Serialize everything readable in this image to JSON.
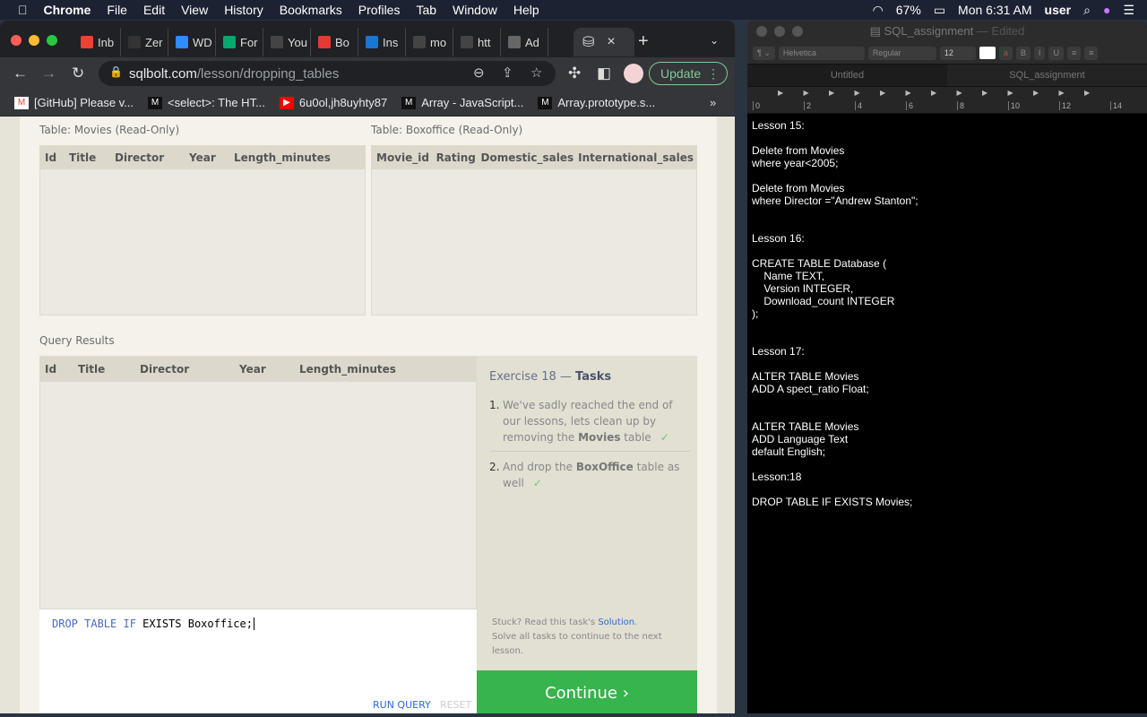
{
  "menubar": {
    "app": "Chrome",
    "items": [
      "File",
      "Edit",
      "View",
      "History",
      "Bookmarks",
      "Profiles",
      "Tab",
      "Window",
      "Help"
    ],
    "battery": "67%",
    "clock": "Mon 6:31 AM",
    "user": "user"
  },
  "browser": {
    "tabs": [
      {
        "label": "Inb",
        "icon": "gmail-icon",
        "color": "#ea4335"
      },
      {
        "label": "Zer",
        "icon": "zero-icon",
        "color": "#333"
      },
      {
        "label": "WD",
        "icon": "zoom-icon",
        "color": "#2d8cff"
      },
      {
        "label": "For",
        "icon": "w3-icon",
        "color": "#04aa6d"
      },
      {
        "label": "You",
        "icon": "github-icon",
        "color": "#444"
      },
      {
        "label": "Bo",
        "icon": "s-icon",
        "color": "#e53935"
      },
      {
        "label": "Ins",
        "icon": "mj-icon",
        "color": "#1976d2"
      },
      {
        "label": "mo",
        "icon": "mockapi-icon",
        "color": "#444"
      },
      {
        "label": "htt",
        "icon": "mockapi-icon",
        "color": "#444"
      },
      {
        "label": "Ad",
        "icon": "globe-icon",
        "color": "#666"
      }
    ],
    "active_tab_close": "×",
    "url_host": "sqlbolt.com",
    "url_path": "/lesson/dropping_tables",
    "update_label": "Update",
    "bookmarks": [
      {
        "label": "[GitHub] Please v...",
        "icon": "gmail-icon"
      },
      {
        "label": "<select>: The HT...",
        "icon": "mdn-icon"
      },
      {
        "label": "6u0ol,jh8uyhty87",
        "icon": "youtube-icon"
      },
      {
        "label": "Array - JavaScript...",
        "icon": "mdn-icon"
      },
      {
        "label": "Array.prototype.s...",
        "icon": "mdn-icon"
      }
    ]
  },
  "page": {
    "movies_label": "Table: Movies (Read-Only)",
    "movies_columns": [
      "Id",
      "Title",
      "Director",
      "Year",
      "Length_minutes"
    ],
    "boxoffice_label": "Table: Boxoffice (Read-Only)",
    "boxoffice_columns": [
      "Movie_id",
      "Rating",
      "Domestic_sales",
      "International_sales"
    ],
    "results_label": "Query Results",
    "results_columns": [
      "Id",
      "Title",
      "Director",
      "Year",
      "Length_minutes"
    ],
    "exercise_title": "Exercise 18",
    "exercise_sub": "Tasks",
    "tasks": [
      {
        "num": "1.",
        "pre": "We've sadly reached the end of our lessons, lets clean up by removing the ",
        "bold": "Movies",
        "post": " table",
        "check": "✓"
      },
      {
        "num": "2.",
        "pre": "And drop the ",
        "bold": "BoxOffice",
        "post": " table as well",
        "check": "✓"
      }
    ],
    "stuck_pre": "Stuck? Read this task's ",
    "solution": "Solution",
    "stuck_post": ".",
    "solve_note": "Solve all tasks to continue to the next lesson.",
    "query_kw": "DROP TABLE IF",
    "query_rest": " EXISTS Boxoffice;",
    "run_query": "RUN QUERY",
    "reset": "RESET",
    "continue": "Continue ›",
    "colors": {
      "continue": "#37b44d",
      "keyword": "#4a6bbf",
      "link": "#2a6ad6"
    }
  },
  "textedit": {
    "title": "SQL_assignment",
    "edited": "— Edited",
    "font": "Helvetica",
    "style": "Regular",
    "size": "12",
    "tabs": [
      "Untitled",
      "SQL_assignment"
    ],
    "ruler": [
      "0",
      "2",
      "4",
      "6",
      "8",
      "10",
      "12",
      "14"
    ],
    "lines": [
      "Lesson 15:",
      "",
      "Delete from Movies",
      "where year<2005;",
      "",
      "Delete from Movies",
      "where Director =\"Andrew Stanton\";",
      "",
      "",
      "Lesson 16:",
      "",
      "CREATE TABLE Database (",
      "    Name TEXT,",
      "    Version INTEGER,",
      "    Download_count INTEGER",
      ");",
      "",
      "",
      "Lesson 17:",
      "",
      "ALTER TABLE Movies",
      "ADD A spect_ratio Float;",
      "",
      "",
      "ALTER TABLE Movies",
      "ADD Language Text",
      "default English;",
      "",
      "Lesson:18",
      "",
      "DROP TABLE IF EXISTS Movies;"
    ]
  }
}
